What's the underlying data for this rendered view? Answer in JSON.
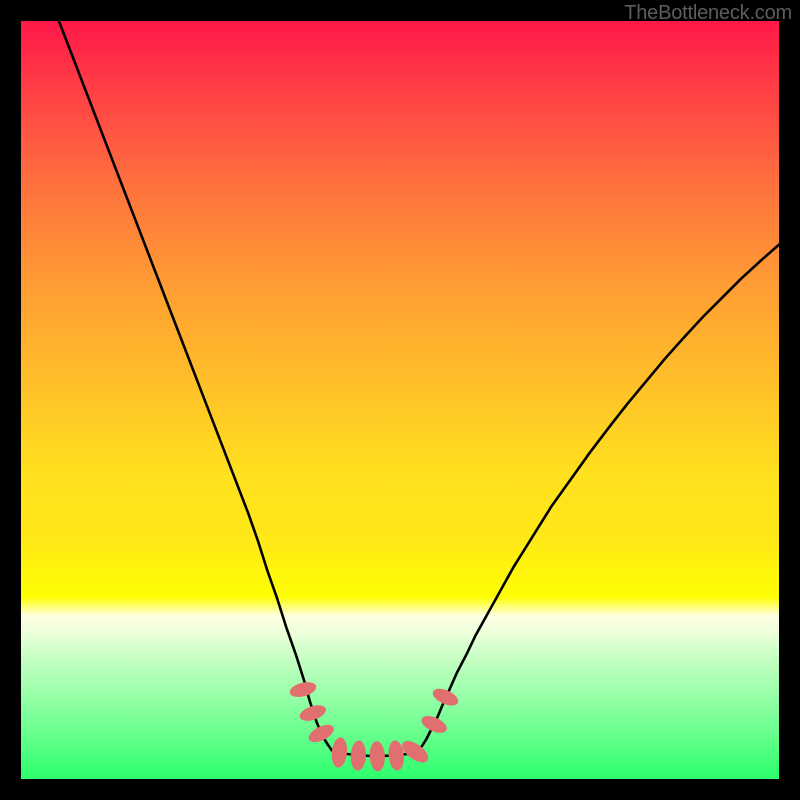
{
  "watermark": "TheBottleneck.com",
  "chart_data": {
    "type": "line",
    "title": "",
    "xlabel": "",
    "ylabel": "",
    "xlim": [
      0,
      100
    ],
    "ylim": [
      0,
      100
    ],
    "grid": false,
    "legend": false,
    "background_gradient": {
      "top_color": "#ff1849",
      "mid_color": "#ffe11e",
      "bottom_color": "#2dff6d"
    },
    "series": [
      {
        "name": "left-curve",
        "stroke": "#000000",
        "x": [
          5.0,
          7.5,
          10.0,
          12.5,
          15.0,
          17.5,
          20.0,
          22.5,
          25.0,
          27.5,
          30.0,
          31.3,
          32.5,
          33.8,
          35.0,
          36.3,
          37.5,
          38.0,
          38.5,
          39.0,
          39.5,
          40.0,
          40.5,
          41.0
        ],
        "y": [
          100.0,
          93.5,
          87.0,
          80.5,
          74.0,
          67.5,
          61.0,
          54.5,
          48.0,
          41.5,
          35.0,
          31.3,
          27.5,
          23.8,
          20.0,
          16.3,
          12.5,
          10.6,
          9.0,
          7.5,
          6.3,
          5.3,
          4.5,
          3.8
        ]
      },
      {
        "name": "right-curve",
        "stroke": "#000000",
        "x": [
          52.5,
          53.0,
          53.5,
          54.0,
          54.5,
          55.0,
          55.5,
          56.3,
          57.5,
          58.8,
          60.0,
          62.5,
          65.0,
          67.5,
          70.0,
          72.5,
          75.0,
          77.5,
          80.0,
          82.5,
          85.0,
          87.5,
          90.0,
          92.5,
          95.0,
          97.5,
          100.0
        ],
        "y": [
          3.8,
          4.5,
          5.3,
          6.3,
          7.2,
          8.3,
          9.5,
          11.3,
          14.0,
          16.5,
          19.0,
          23.5,
          28.0,
          32.0,
          36.0,
          39.5,
          43.0,
          46.3,
          49.5,
          52.5,
          55.5,
          58.3,
          61.0,
          63.5,
          66.0,
          68.3,
          70.5
        ]
      },
      {
        "name": "bottom-flat",
        "stroke": "#000000",
        "x": [
          41.0,
          43.0,
          45.0,
          47.0,
          49.0,
          51.0,
          52.5
        ],
        "y": [
          3.8,
          3.3,
          3.1,
          3.0,
          3.1,
          3.3,
          3.8
        ]
      }
    ],
    "markers": [
      {
        "name": "m1",
        "x": 37.2,
        "y": 11.8,
        "r": 0.9,
        "color": "#e16f6f"
      },
      {
        "name": "m2",
        "x": 38.5,
        "y": 8.7,
        "r": 0.9,
        "color": "#e16f6f"
      },
      {
        "name": "m3",
        "x": 39.6,
        "y": 6.0,
        "r": 0.9,
        "color": "#e16f6f"
      },
      {
        "name": "m4",
        "x": 42.0,
        "y": 3.5,
        "r": 1.0,
        "color": "#e16f6f"
      },
      {
        "name": "m5",
        "x": 44.5,
        "y": 3.1,
        "r": 1.0,
        "color": "#e16f6f"
      },
      {
        "name": "m6",
        "x": 47.0,
        "y": 3.0,
        "r": 1.0,
        "color": "#e16f6f"
      },
      {
        "name": "m7",
        "x": 49.5,
        "y": 3.1,
        "r": 1.0,
        "color": "#e16f6f"
      },
      {
        "name": "m8",
        "x": 52.0,
        "y": 3.6,
        "r": 1.0,
        "color": "#e16f6f"
      },
      {
        "name": "m9",
        "x": 54.5,
        "y": 7.2,
        "r": 0.9,
        "color": "#e16f6f"
      },
      {
        "name": "m10",
        "x": 56.0,
        "y": 10.8,
        "r": 0.9,
        "color": "#e16f6f"
      }
    ]
  }
}
